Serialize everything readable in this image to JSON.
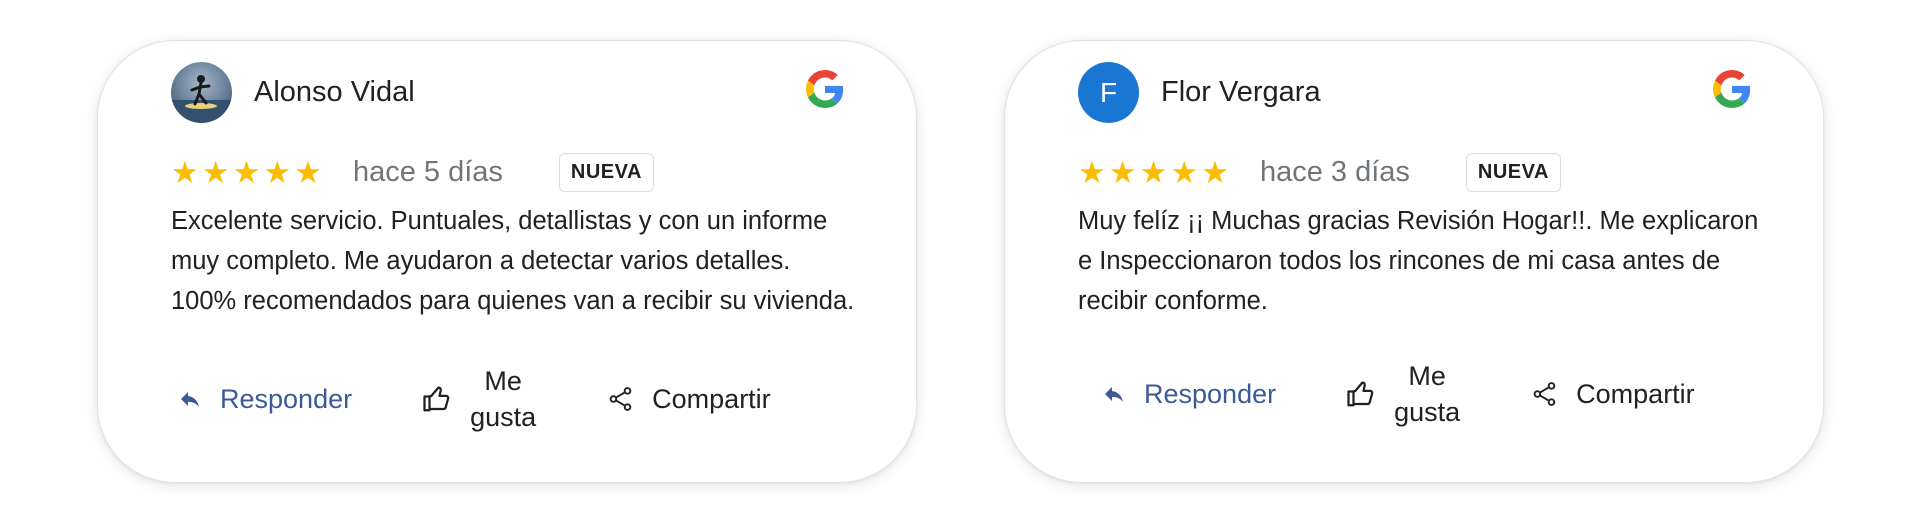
{
  "reviews": [
    {
      "author": "Alonso Vidal",
      "avatar": "profile-photo-surfer",
      "rating": 5,
      "stars": "★★★★★",
      "time": "hace 5 días",
      "badge": "NUEVA",
      "text": "Excelente servicio. Puntuales, detallistas y con un informe muy completo. Me ayudaron a detectar varios detalles. 100% recomendados para quienes van a recibir su vivienda.",
      "actions": {
        "reply": "Responder",
        "like_line1": "Me",
        "like_line2": "gusta",
        "share": "Compartir"
      }
    },
    {
      "author": "Flor Vergara",
      "avatar_initial": "F",
      "avatar_color": "#1976d2",
      "rating": 5,
      "stars": "★★★★★",
      "time": "hace 3 días",
      "badge": "NUEVA",
      "text": "Muy felíz ¡¡ Muchas gracias  Revisión Hogar!!. Me explicaron e Inspeccionaron   todos los rincones de mi casa antes de recibir conforme.",
      "actions": {
        "reply": "Responder",
        "like_line1": "Me",
        "like_line2": "gusta",
        "share": "Compartir"
      }
    }
  ],
  "icons": {
    "source": "google-g-logo",
    "reply": "reply-arrow-icon",
    "like": "thumbs-up-icon",
    "share": "share-icon"
  },
  "colors": {
    "star": "#fbbc04",
    "reply": "#3c5a99",
    "avatar_f": "#1976d2"
  }
}
